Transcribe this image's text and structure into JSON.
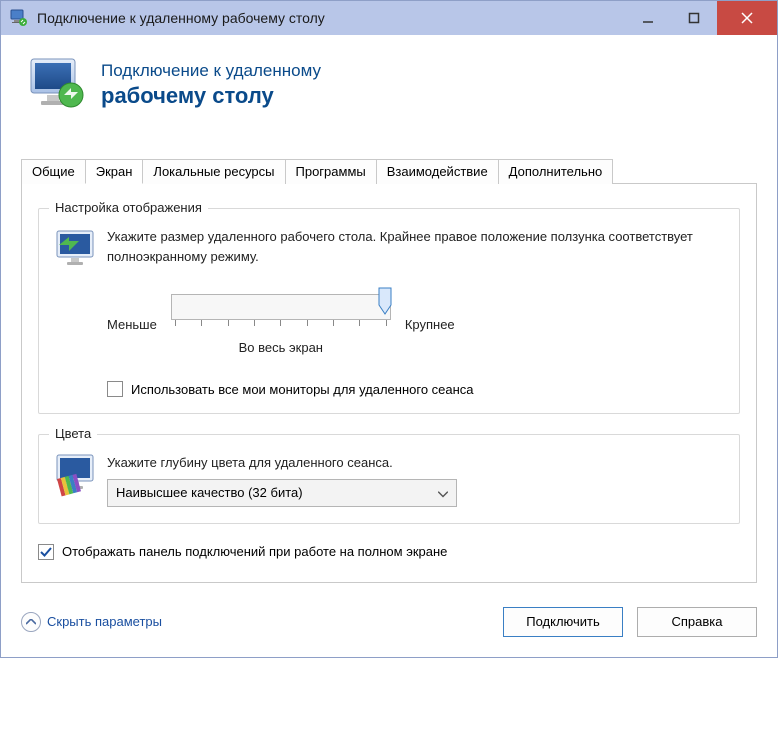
{
  "window": {
    "title": "Подключение к удаленному рабочему столу"
  },
  "header": {
    "line1": "Подключение к удаленному",
    "line2": "рабочему столу"
  },
  "tabs": {
    "general": "Общие",
    "display": "Экран",
    "local": "Локальные ресурсы",
    "programs": "Программы",
    "experience": "Взаимодействие",
    "advanced": "Дополнительно"
  },
  "displaySettings": {
    "legend": "Настройка отображения",
    "description": "Укажите размер удаленного рабочего стола. Крайнее правое положение ползунка соответствует полноэкранному режиму.",
    "smaller": "Меньше",
    "larger": "Крупнее",
    "fullscreen": "Во весь экран",
    "useAllMonitors": "Использовать все мои мониторы для удаленного сеанса",
    "useAllMonitorsChecked": false
  },
  "colors": {
    "legend": "Цвета",
    "description": "Укажите глубину цвета для удаленного сеанса.",
    "selected": "Наивысшее качество (32 бита)"
  },
  "showConnectionBar": {
    "label": "Отображать панель подключений при работе на полном экране",
    "checked": true
  },
  "footer": {
    "hideOptions": "Скрыть параметры",
    "connect": "Подключить",
    "help": "Справка"
  }
}
